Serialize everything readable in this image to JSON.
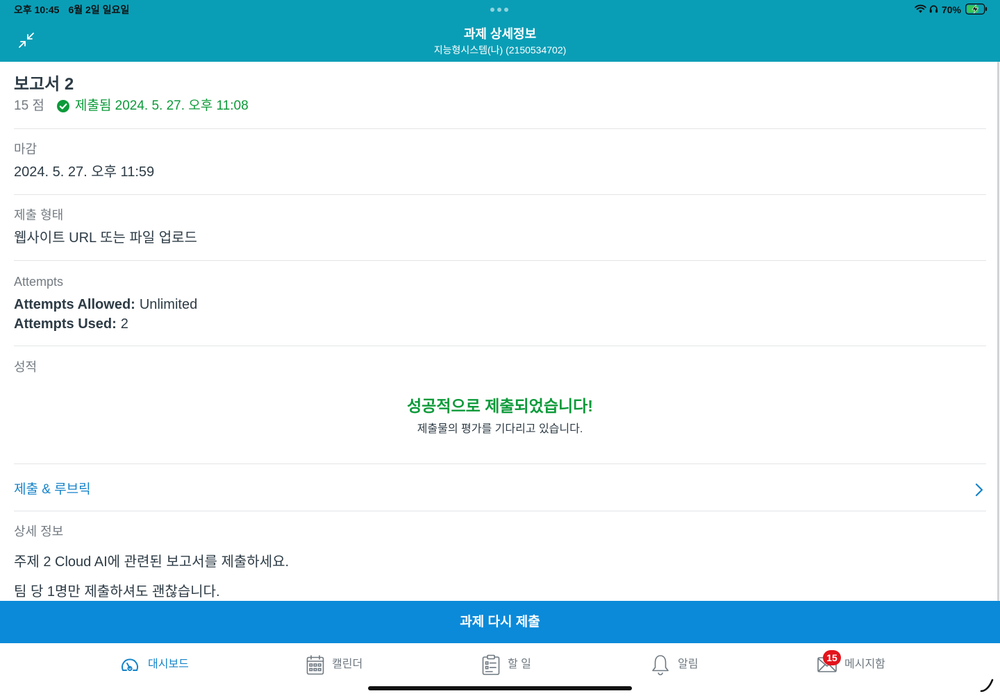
{
  "colors": {
    "header": "#0A9EB6",
    "primary": "#0B8AD9",
    "success": "#0C9A3A",
    "link": "#1483C9",
    "badge": "#E3141C"
  },
  "status_bar": {
    "time": "오후 10:45",
    "date": "6월 2일 일요일",
    "battery": "70%",
    "icons": [
      "wifi-icon",
      "headphones-icon",
      "battery-charging-icon"
    ]
  },
  "header": {
    "title": "과제 상세정보",
    "subtitle": "지능형시스템(나) (2150534702)",
    "left_icon": "collapse-icon"
  },
  "assignment": {
    "title": "보고서 2",
    "points": "15 점",
    "submission_status": "제출됨 2024. 5. 27. 오후 11:08",
    "status_icon": "check-circle-icon"
  },
  "due": {
    "label": "마감",
    "value": "2024. 5. 27. 오후 11:59"
  },
  "submission_type": {
    "label": "제출 형태",
    "value": "웹사이트 URL 또는 파일 업로드"
  },
  "attempts": {
    "label": "Attempts",
    "allowed_label": "Attempts Allowed:",
    "allowed_value": "Unlimited",
    "used_label": "Attempts Used:",
    "used_value": "2"
  },
  "grade": {
    "label": "성적",
    "message": "성공적으로 제출되었습니다!",
    "submessage": "제출물의 평가를 기다리고 있습니다."
  },
  "rubric_link": {
    "label": "제출 & 루브릭",
    "icon": "chevron-right-icon"
  },
  "details": {
    "label": "상세 정보",
    "paragraphs": [
      "주제 2 Cloud AI에 관련된 보고서를 제출하세요.",
      "팀 당 1명만 제출하셔도 괜찮습니다."
    ]
  },
  "action_button": {
    "label": "과제 다시 제출"
  },
  "tab_bar": {
    "items": [
      {
        "label": "대시보드",
        "icon": "dashboard-gauge-icon",
        "active": true
      },
      {
        "label": "캘린더",
        "icon": "calendar-icon",
        "active": false
      },
      {
        "label": "할 일",
        "icon": "clipboard-icon",
        "active": false
      },
      {
        "label": "알림",
        "icon": "bell-icon",
        "active": false
      },
      {
        "label": "메시지함",
        "icon": "envelope-icon",
        "active": false,
        "badge": "15"
      }
    ]
  }
}
